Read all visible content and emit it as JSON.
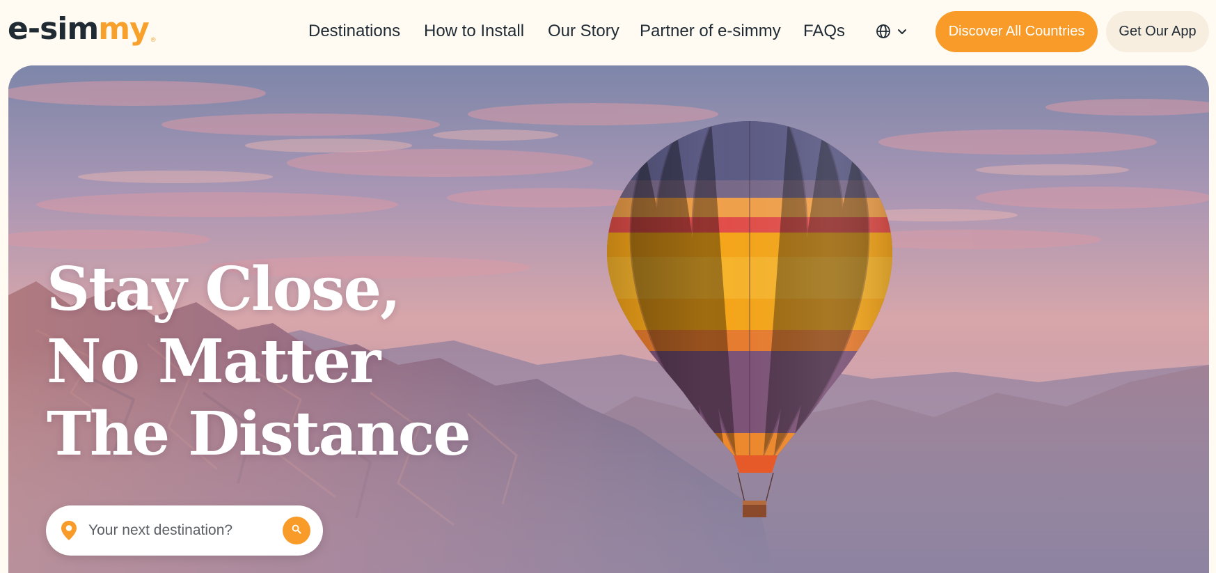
{
  "logo": {
    "part_dark": "e-sim",
    "part_accent": "my",
    "registered": "®"
  },
  "nav": {
    "items": [
      {
        "label": "Destinations"
      },
      {
        "label": "How to Install"
      },
      {
        "label": "Our Story"
      },
      {
        "label": "Partner of e-simmy"
      },
      {
        "label": "FAQs"
      }
    ],
    "language_icon": "globe-icon",
    "language_caret": "chevron-down-icon"
  },
  "actions": {
    "primary_label": "Discover All Countries",
    "secondary_label": "Get Our App"
  },
  "hero": {
    "headline_lines": [
      "Stay Close,",
      "No Matter",
      "The Distance"
    ],
    "image_subject": "hot-air-balloon-over-desert-mountains"
  },
  "search": {
    "placeholder": "Your next destination?",
    "value": "",
    "pin_icon": "location-pin-icon",
    "button_icon": "search-icon"
  },
  "colors": {
    "accent": "#f99b28",
    "text_dark": "#1f2a33",
    "header_bg": "#fffbf3",
    "secondary_btn_bg": "#f7eee0"
  }
}
